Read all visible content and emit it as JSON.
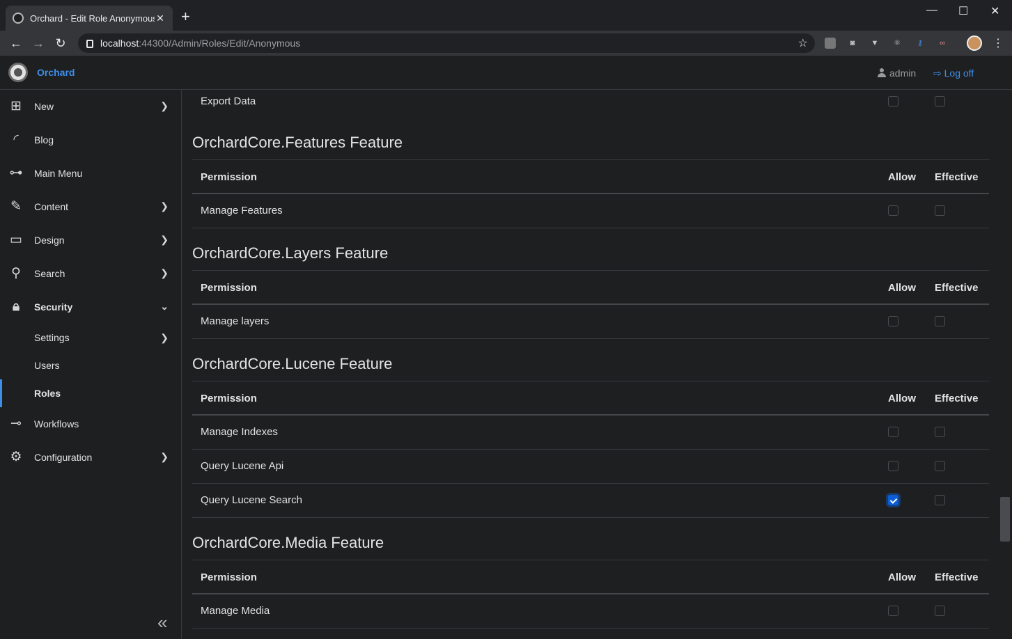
{
  "browser": {
    "tab_title": "Orchard - Edit Role Anonymous",
    "tab_close": "✕",
    "new_tab": "+",
    "url_host": "localhost",
    "url_path": ":44300/Admin/Roles/Edit/Anonymous",
    "win_min": "—",
    "win_max": "☐",
    "win_close": "✕"
  },
  "header": {
    "brand": "Orchard",
    "user": "admin",
    "logoff": "Log off"
  },
  "sidebar": {
    "items": [
      {
        "label": "New",
        "icon": "plus-square-icon"
      },
      {
        "label": "Blog",
        "icon": "rss-icon"
      },
      {
        "label": "Main Menu",
        "icon": "sitemap-icon"
      },
      {
        "label": "Content",
        "icon": "edit-icon"
      },
      {
        "label": "Design",
        "icon": "desktop-icon"
      },
      {
        "label": "Search",
        "icon": "search-icon"
      },
      {
        "label": "Security",
        "icon": "lock-icon"
      },
      {
        "label": "Settings"
      },
      {
        "label": "Users"
      },
      {
        "label": "Roles"
      },
      {
        "label": "Workflows",
        "icon": "workflow-icon"
      },
      {
        "label": "Configuration",
        "icon": "gear-icon"
      }
    ]
  },
  "table_headers": {
    "permission": "Permission",
    "allow": "Allow",
    "effective": "Effective"
  },
  "main": {
    "top_row": {
      "label": "Export Data"
    },
    "features": [
      {
        "title": "OrchardCore.Features Feature",
        "rows": [
          {
            "label": "Manage Features",
            "allow": false,
            "effective": false
          }
        ]
      },
      {
        "title": "OrchardCore.Layers Feature",
        "rows": [
          {
            "label": "Manage layers",
            "allow": false,
            "effective": false
          }
        ]
      },
      {
        "title": "OrchardCore.Lucene Feature",
        "rows": [
          {
            "label": "Manage Indexes",
            "allow": false,
            "effective": false
          },
          {
            "label": "Query Lucene Api",
            "allow": false,
            "effective": false
          },
          {
            "label": "Query Lucene Search",
            "allow": true,
            "effective": false
          }
        ]
      },
      {
        "title": "OrchardCore.Media Feature",
        "rows": [
          {
            "label": "Manage Media",
            "allow": false,
            "effective": false
          }
        ]
      }
    ]
  },
  "colors": {
    "accent": "#3d8ee8",
    "checked": "#0b5ed7",
    "background": "#1e1f21"
  }
}
